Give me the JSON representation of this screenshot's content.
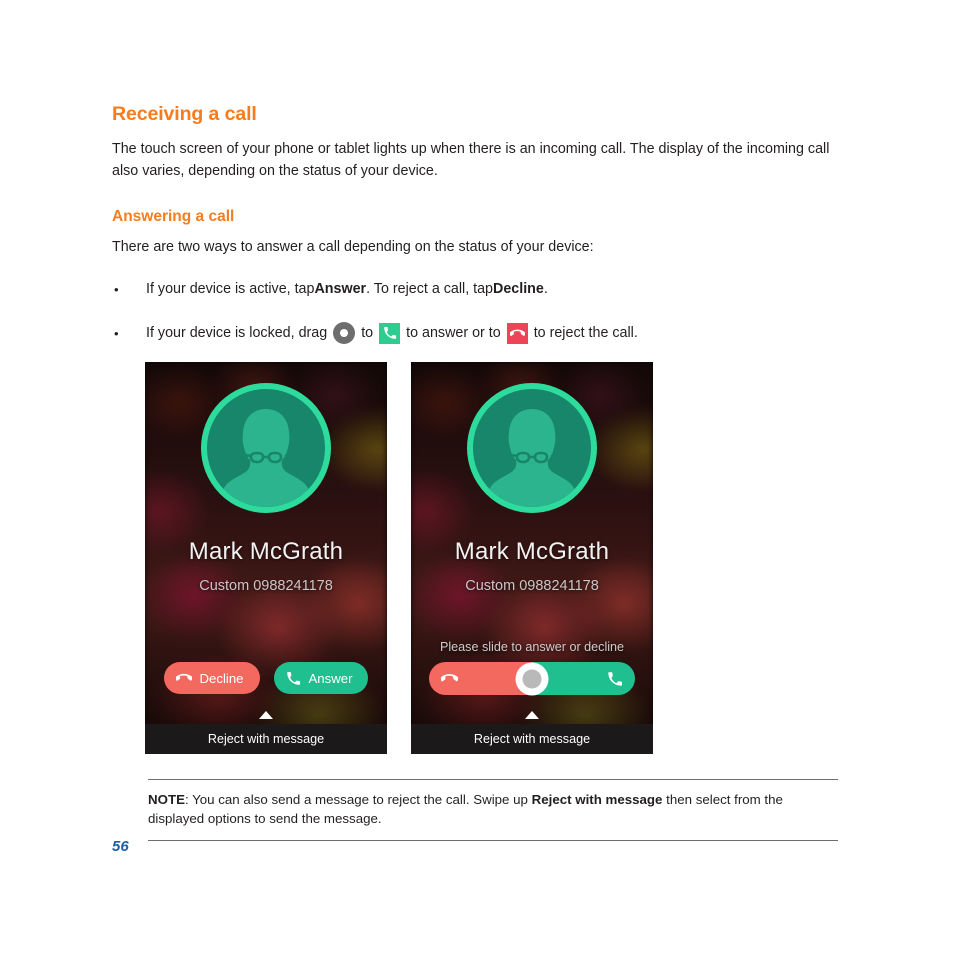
{
  "document": {
    "heading": "Receiving a call",
    "intro": "The touch screen of your phone or tablet lights up when there is an incoming call. The display of the incoming call also varies, depending on the status of your device.",
    "subheading": "Answering a call",
    "lead": "There are two ways to answer a call depending on the status of your device:",
    "bullet_marker": "•",
    "bullets": [
      {
        "part1": "If your device is active, tap ",
        "bold1": "Answer",
        "part2": ". To reject a call, tap ",
        "bold2": "Decline",
        "part3": "."
      },
      {
        "part1": "If your device is locked, drag ",
        "part2": " to ",
        "part3": " to answer or to ",
        "part4": " to reject the call."
      }
    ],
    "note": {
      "label": "NOTE",
      "text_before": ":  You can also send a message to reject the call. Swipe up ",
      "bold": "Reject with message",
      "text_after": " then select from the displayed options to send the message."
    },
    "page_number": "56"
  },
  "icons": {
    "drag_handle": "drag-handle-icon",
    "answer_square": "answer-phone-icon",
    "decline_square": "decline-phone-icon",
    "avatar": "contact-avatar-icon",
    "caret_up": "caret-up-icon"
  },
  "phone_active": {
    "caller_name": "Mark McGrath",
    "caller_label": "Custom 0988241178",
    "decline_label": "Decline",
    "answer_label": "Answer",
    "reject_bar_label": "Reject with message"
  },
  "phone_locked": {
    "caller_name": "Mark McGrath",
    "caller_label": "Custom 0988241178",
    "slide_hint": "Please slide to answer or decline",
    "reject_bar_label": "Reject with message"
  },
  "colors": {
    "heading_orange": "#F57C1F",
    "page_number_blue": "#1F5FA8",
    "decline_red": "#F4695F",
    "answer_green": "#1FBF8F",
    "avatar_ring_teal": "#2DDC9C",
    "avatar_fill_teal": "#17866B",
    "reject_bar_dark": "#1B1919",
    "body_text": "#231F20"
  }
}
